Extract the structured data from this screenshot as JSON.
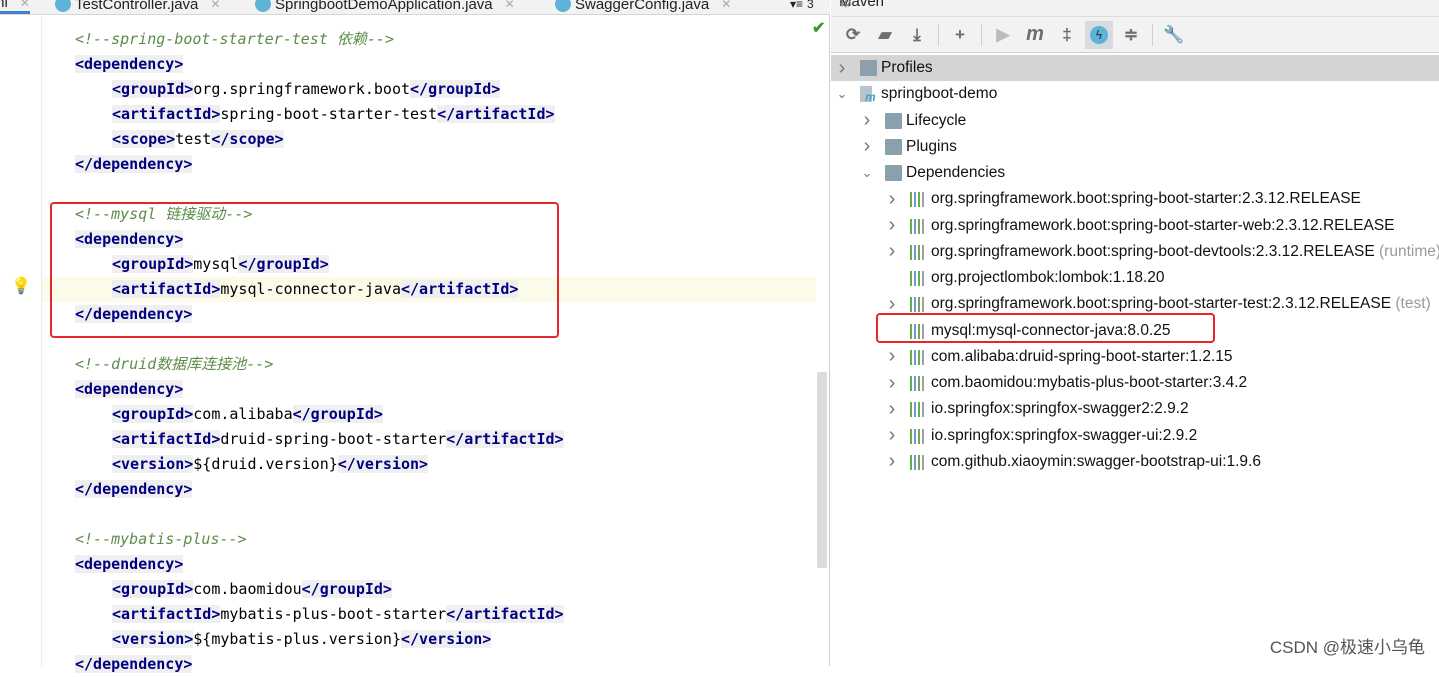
{
  "editor": {
    "tabs": [
      {
        "label": "ml",
        "active": true
      },
      {
        "label": "TestController.java"
      },
      {
        "label": "SpringbootDemoApplication.java"
      },
      {
        "label": "SwaggerConfig.java"
      }
    ],
    "tab_overflow": "3",
    "lines": [
      {
        "i": 1,
        "p": [
          [
            "comment",
            "<!--spring-boot-starter-test 依赖-->"
          ]
        ]
      },
      {
        "i": 1,
        "p": [
          [
            "tag",
            "<dependency>"
          ]
        ]
      },
      {
        "i": 2,
        "p": [
          [
            "tag",
            "<groupId>"
          ],
          [
            "text",
            "org.springframework.boot"
          ],
          [
            "tag",
            "</groupId>"
          ]
        ]
      },
      {
        "i": 2,
        "p": [
          [
            "tag",
            "<artifactId>"
          ],
          [
            "text",
            "spring-boot-starter-test"
          ],
          [
            "tag",
            "</artifactId>"
          ]
        ]
      },
      {
        "i": 2,
        "p": [
          [
            "tag",
            "<scope>"
          ],
          [
            "text",
            "test"
          ],
          [
            "tag",
            "</scope>"
          ]
        ]
      },
      {
        "i": 1,
        "p": [
          [
            "tag",
            "</dependency>"
          ]
        ]
      },
      {
        "i": 1,
        "p": []
      },
      {
        "i": 1,
        "p": [
          [
            "comment",
            "<!--mysql 链接驱动-->"
          ]
        ]
      },
      {
        "i": 1,
        "p": [
          [
            "tag",
            "<dependency>"
          ]
        ]
      },
      {
        "i": 2,
        "p": [
          [
            "tag",
            "<groupId>"
          ],
          [
            "text",
            "mysql"
          ],
          [
            "tag",
            "</groupId>"
          ]
        ]
      },
      {
        "i": 2,
        "hl": true,
        "p": [
          [
            "tag",
            "<artifactId>"
          ],
          [
            "text",
            "mysql-connector-java"
          ],
          [
            "tag",
            "</artifactId>"
          ]
        ]
      },
      {
        "i": 1,
        "p": [
          [
            "tag",
            "</dependency>"
          ]
        ]
      },
      {
        "i": 1,
        "p": []
      },
      {
        "i": 1,
        "p": [
          [
            "comment",
            "<!--druid数据库连接池-->"
          ]
        ]
      },
      {
        "i": 1,
        "p": [
          [
            "tag",
            "<dependency>"
          ]
        ]
      },
      {
        "i": 2,
        "p": [
          [
            "tag",
            "<groupId>"
          ],
          [
            "text",
            "com.alibaba"
          ],
          [
            "tag",
            "</groupId>"
          ]
        ]
      },
      {
        "i": 2,
        "p": [
          [
            "tag",
            "<artifactId>"
          ],
          [
            "text",
            "druid-spring-boot-starter"
          ],
          [
            "tag",
            "</artifactId>"
          ]
        ]
      },
      {
        "i": 2,
        "p": [
          [
            "tag",
            "<version>"
          ],
          [
            "text",
            "${druid.version}"
          ],
          [
            "tag",
            "</version>"
          ]
        ]
      },
      {
        "i": 1,
        "p": [
          [
            "tag",
            "</dependency>"
          ]
        ]
      },
      {
        "i": 1,
        "p": []
      },
      {
        "i": 1,
        "p": [
          [
            "comment",
            "<!--mybatis-plus-->"
          ]
        ]
      },
      {
        "i": 1,
        "p": [
          [
            "tag",
            "<dependency>"
          ]
        ]
      },
      {
        "i": 2,
        "p": [
          [
            "tag",
            "<groupId>"
          ],
          [
            "text",
            "com.baomidou"
          ],
          [
            "tag",
            "</groupId>"
          ]
        ]
      },
      {
        "i": 2,
        "p": [
          [
            "tag",
            "<artifactId>"
          ],
          [
            "text",
            "mybatis-plus-boot-starter"
          ],
          [
            "tag",
            "</artifactId>"
          ]
        ]
      },
      {
        "i": 2,
        "p": [
          [
            "tag",
            "<version>"
          ],
          [
            "text",
            "${mybatis-plus.version}"
          ],
          [
            "tag",
            "</version>"
          ]
        ]
      },
      {
        "i": 1,
        "p": [
          [
            "tag",
            "</dependency>"
          ]
        ]
      }
    ]
  },
  "maven": {
    "title": "Maven",
    "toolbar": [
      "reload-icon",
      "generate-sources-icon",
      "download-icon",
      "add-icon",
      "run-icon",
      "maven-goal-icon",
      "skip-tests-icon",
      "offline-mode-icon",
      "collapse-all-icon",
      "settings-wrench-icon"
    ],
    "tree": [
      {
        "label": "Profiles",
        "level": 0,
        "arrow": "right",
        "icon": "folder",
        "selected": true
      },
      {
        "label": "springboot-demo",
        "level": 0,
        "arrow": "down",
        "icon": "maven-project"
      },
      {
        "label": "Lifecycle",
        "level": 1,
        "arrow": "right",
        "icon": "folder"
      },
      {
        "label": "Plugins",
        "level": 1,
        "arrow": "right",
        "icon": "folder"
      },
      {
        "label": "Dependencies",
        "level": 1,
        "arrow": "down",
        "icon": "folder"
      },
      {
        "label": "org.springframework.boot:spring-boot-starter:2.3.12.RELEASE",
        "level": 2,
        "arrow": "right",
        "icon": "lib"
      },
      {
        "label": "org.springframework.boot:spring-boot-starter-web:2.3.12.RELEASE",
        "level": 2,
        "arrow": "right",
        "icon": "lib"
      },
      {
        "label": "org.springframework.boot:spring-boot-devtools:2.3.12.RELEASE",
        "suffix": "(runtime)",
        "level": 2,
        "arrow": "right",
        "icon": "lib"
      },
      {
        "label": "org.projectlombok:lombok:1.18.20",
        "level": 2,
        "arrow": "",
        "icon": "lib"
      },
      {
        "label": "org.springframework.boot:spring-boot-starter-test:2.3.12.RELEASE",
        "suffix": "(test)",
        "level": 2,
        "arrow": "right",
        "icon": "lib"
      },
      {
        "label": "mysql:mysql-connector-java:8.0.25",
        "level": 2,
        "arrow": "",
        "icon": "lib"
      },
      {
        "label": "com.alibaba:druid-spring-boot-starter:1.2.15",
        "level": 2,
        "arrow": "right",
        "icon": "lib"
      },
      {
        "label": "com.baomidou:mybatis-plus-boot-starter:3.4.2",
        "level": 2,
        "arrow": "right",
        "icon": "lib"
      },
      {
        "label": "io.springfox:springfox-swagger2:2.9.2",
        "level": 2,
        "arrow": "right",
        "icon": "lib"
      },
      {
        "label": "io.springfox:springfox-swagger-ui:2.9.2",
        "level": 2,
        "arrow": "right",
        "icon": "lib"
      },
      {
        "label": "com.github.xiaoymin:swagger-bootstrap-ui:1.9.6",
        "level": 2,
        "arrow": "right",
        "icon": "lib"
      }
    ]
  },
  "watermark": "CSDN @极速小乌龟",
  "colors": {
    "highlight_box": "#e8252a",
    "tag": "#000080",
    "comment": "#5c8c4a"
  }
}
